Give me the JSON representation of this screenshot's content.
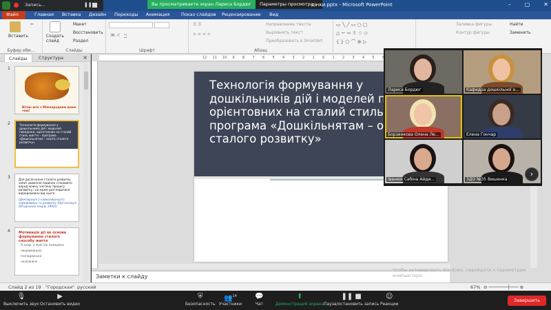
{
  "titlebar": {
    "file_name": "дінки.pptx - Microsoft PowerPoint",
    "recording": "Запись...",
    "viewing_banner": "Вы просматриваете экран Лариса Бордюг",
    "view_options": "Параметры просмотра ⌄",
    "minimize": "–",
    "restore": "▢",
    "close": "✕"
  },
  "menu": {
    "file": "Файл",
    "tabs": [
      "Главная",
      "Вставка",
      "Дизайн",
      "Переходы",
      "Анимация",
      "Показ слайдов",
      "Рецензирование",
      "Вид"
    ]
  },
  "ribbon": {
    "paste": "Вставить",
    "create_slide": "Создать слайд",
    "layout": "Макет",
    "reset": "Восстановить",
    "section": "Раздел",
    "clipboard_label": "Буфер обм...",
    "slides_label": "Слайды",
    "font_label": "Шрифт",
    "paragraph_label": "Абзац",
    "text_direction": "Направление текста",
    "align_text": "Выровнять текст",
    "smartart": "Преобразовать в SmartArt",
    "shape_fill": "Заливка фигуры",
    "shape_outline": "Контур фигуры",
    "find": "Найти",
    "replace": "Заменить"
  },
  "panel": {
    "tab_slides": "Слайды",
    "tab_outline": "Структура",
    "close": "×",
    "thumbs": [
      {
        "num": "1",
        "caption": "Вітаю всіх з Міжнародним днем чаю!"
      },
      {
        "num": "2",
        "caption": "Технологія формування у дошкільників дій і моделей поведінки, орієнтовних на сталий стиль життя – програма «Дошкільнятам – освіта сталого розвитку»"
      },
      {
        "num": "3",
        "caption": "Для досягнення сталого розвитку запит довкілля повинен становити веред кожну частину процесу розвитку і не може розглядатися відокремлено від нього.",
        "caption2": "(Декларація з навколишнього середовища та розвитку (Організація Об'єднаних Націй, 1992))"
      },
      {
        "num": "4",
        "caption": "Мотивація дії як основа формування сталого способу життя",
        "items": [
          "Я знаю, у якій ітеі позиціяно",
          "нащадницько",
          "господарсько",
          "незалежно"
        ]
      }
    ]
  },
  "slide": {
    "title": "Технологія формування у дошкільників дій і моделей поведінки, орієнтовних на сталий стиль життя – програма «Дошкільнятам – освіта сталого розвитку»"
  },
  "notes": {
    "placeholder": "Заметки к слайду"
  },
  "ruler": {
    "marks": [
      "12",
      "11",
      "10",
      "9",
      "8",
      "7",
      "6",
      "5",
      "4",
      "3",
      "2",
      "1",
      "0",
      "1",
      "2",
      "3",
      "4",
      "5",
      "6",
      "7",
      "8",
      "9",
      "10",
      "11",
      "12"
    ]
  },
  "status": {
    "slide": "Слайд 2 из 19",
    "theme": "\"Городская\"",
    "lang": "русский",
    "zoom": "67%",
    "activate": "Чтобы активировать Windows, перейдите к параметрам компьютера."
  },
  "gallery": {
    "participants": [
      {
        "name": "Лариса Бордюг",
        "bg": "#6d6a63",
        "skin": "#e2b59e",
        "hair": "#2a1f1a",
        "shirt": "#222"
      },
      {
        "name": "Кафедра дошкільної о...",
        "bg": "#b49d7e",
        "skin": "#f0c2a4",
        "hair": "#c8923c",
        "shirt": "#7a4b2c"
      },
      {
        "name": "Борзенкова Олена Ле...",
        "bg": "#8b6f63",
        "skin": "#f0c4a7",
        "hair": "#f1e3b0",
        "shirt": "#c0392b"
      },
      {
        "name": "Елена Гончар",
        "bg": "#343a46",
        "skin": "#c9a08a",
        "hair": "#3a2a22",
        "shirt": "#2f3d6b"
      },
      {
        "name": "Іванюк Сабіна Айди...",
        "bg": "#cfcfcf",
        "skin": "#d9a98e",
        "hair": "#1a1210",
        "shirt": "#333"
      },
      {
        "name": "ЗДО №35 Вишенка",
        "bg": "#b8b2a8",
        "skin": "#d5a78d",
        "hair": "#18110e",
        "shirt": "#1b1b1b"
      }
    ],
    "next": "›"
  },
  "toolbar": {
    "mute": "Выключить звук",
    "video": "Остановить видео",
    "security": "Безопасность",
    "participants": "Участники",
    "participants_count": "14",
    "chat": "Чат",
    "share": "Демонстрация экрана",
    "pause_rec": "Пауза/остановить запись",
    "reactions": "Реакции",
    "end": "Завершить"
  }
}
